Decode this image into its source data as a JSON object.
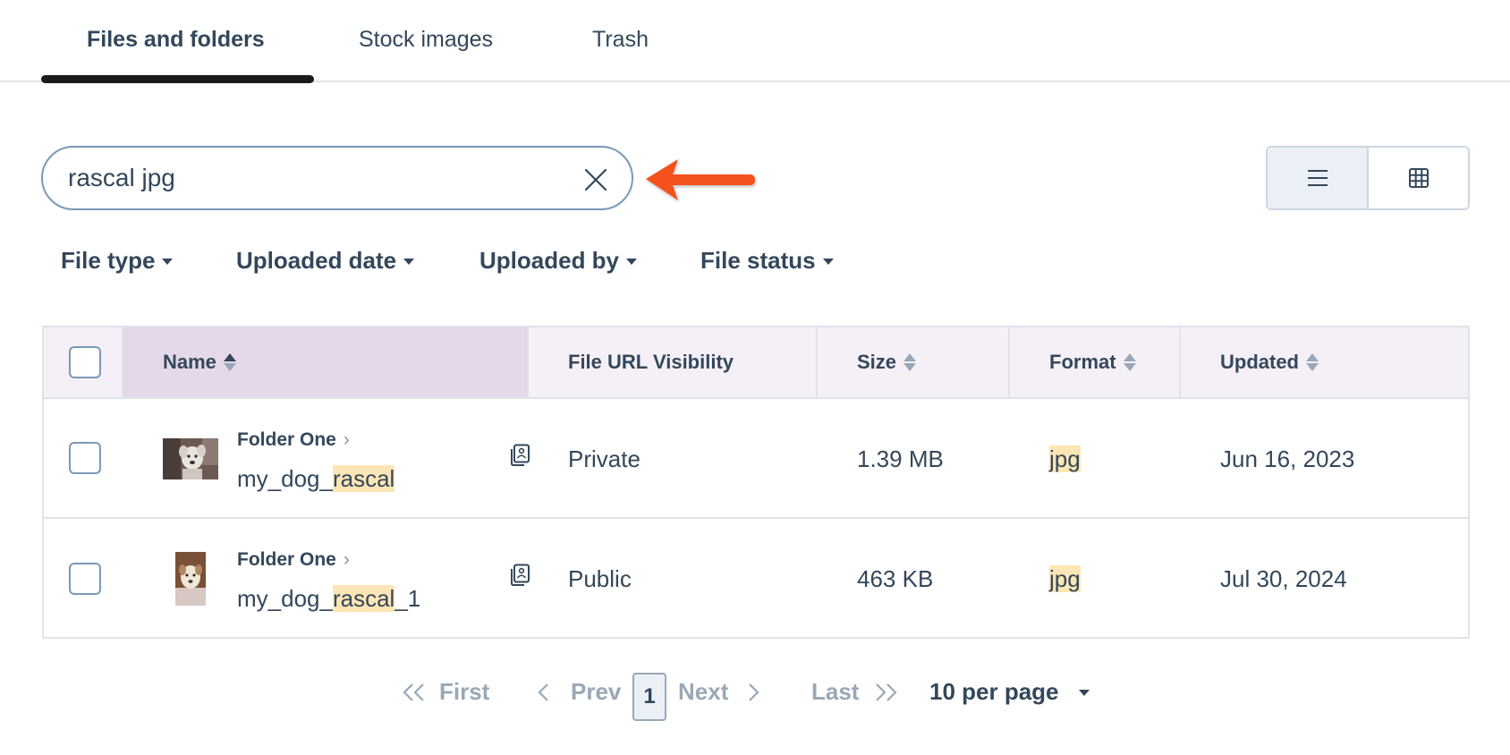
{
  "tabs": [
    {
      "label": "Files and folders",
      "active": true
    },
    {
      "label": "Stock images",
      "active": false
    },
    {
      "label": "Trash",
      "active": false
    }
  ],
  "search": {
    "value": "rascal jpg",
    "placeholder": "Search"
  },
  "view_toggle": {
    "active": "list"
  },
  "filters": [
    {
      "label": "File type"
    },
    {
      "label": "Uploaded date"
    },
    {
      "label": "Uploaded by"
    },
    {
      "label": "File status"
    }
  ],
  "table": {
    "columns": [
      "Name",
      "File URL Visibility",
      "Size",
      "Format",
      "Updated"
    ],
    "rows": [
      {
        "folder": "Folder One",
        "name_prefix": "my_dog_",
        "name_match": "rascal",
        "name_suffix": "",
        "visibility": "Private",
        "size": "1.39 MB",
        "format": "jpg",
        "updated": "Jun 16, 2023"
      },
      {
        "folder": "Folder One",
        "name_prefix": "my_dog_",
        "name_match": "rascal",
        "name_suffix": "_1",
        "visibility": "Public",
        "size": "463 KB",
        "format": "jpg",
        "updated": "Jul 30, 2024"
      }
    ]
  },
  "pagination": {
    "first": "First",
    "prev": "Prev",
    "current_page": "1",
    "next": "Next",
    "last": "Last",
    "per_page": "10 per page"
  },
  "colors": {
    "accent_arrow": "#f4511e",
    "highlight": "#fde6b5",
    "header_bg": "#f5f0f7",
    "sorted_header_bg": "#e5d8e8",
    "text": "#33475b"
  },
  "icons": [
    "close-icon",
    "list-view-icon",
    "grid-view-icon",
    "sort-icon",
    "copy-link-icon",
    "chevron-right-icon",
    "double-chevron-left-icon",
    "chevron-left-icon",
    "double-chevron-right-icon",
    "caret-down-icon",
    "arrow-pointer-icon"
  ]
}
